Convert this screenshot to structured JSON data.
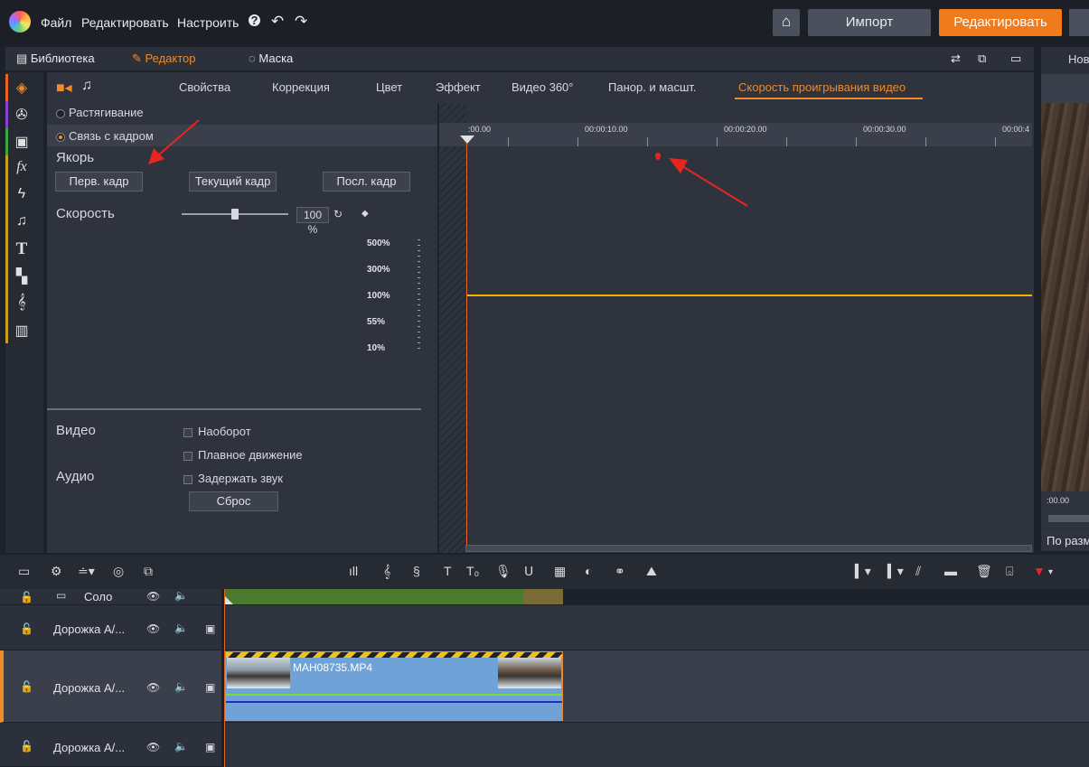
{
  "menu": {
    "file": "Файл",
    "edit": "Редактировать",
    "settings": "Настроить"
  },
  "header": {
    "import": "Импорт",
    "edit": "Редактировать"
  },
  "tabs": {
    "library": "Библиотека",
    "editor": "Редактор",
    "mask": "Маска"
  },
  "right_panel": {
    "tab": "Нов",
    "time": ":00.00",
    "footer": "По разм"
  },
  "prop_tabs": [
    "Свойства",
    "Коррекция",
    "Цвет",
    "Эффект",
    "Видео 360°",
    "Панор. и масшт.",
    "Скорость проигрывания видео"
  ],
  "speed": {
    "mode_stretch": "Растягивание",
    "mode_link": "Связь с кадром",
    "anchor_label": "Якорь",
    "first_frame": "Перв. кадр",
    "current_frame": "Текущий кадр",
    "last_frame": "Посл. кадр",
    "speed_label": "Скорость",
    "speed_value": "100 %",
    "slider_level": 0.5,
    "scale": [
      "500%",
      "300%",
      "100%",
      "55%",
      "10%"
    ],
    "video_label": "Видео",
    "reverse": "Наоборот",
    "smooth": "Плавное движение",
    "audio_label": "Аудио",
    "hold_audio": "Задержать звук",
    "reset": "Сброс"
  },
  "ruler": [
    ":00.00",
    "00:00:10.00",
    "00:00:20.00",
    "00:00:30.00",
    "00:00:4"
  ],
  "tracks": {
    "solo": "Соло",
    "track1": "Дорожка А/...",
    "track2": "Дорожка А/...",
    "track3": "Дорожка А/..."
  },
  "clip": {
    "name": "MAH08735.MP4"
  },
  "colors": {
    "accent": "#f07b1d",
    "speed_line": "#f0b400",
    "annotation": "#e8261f"
  }
}
